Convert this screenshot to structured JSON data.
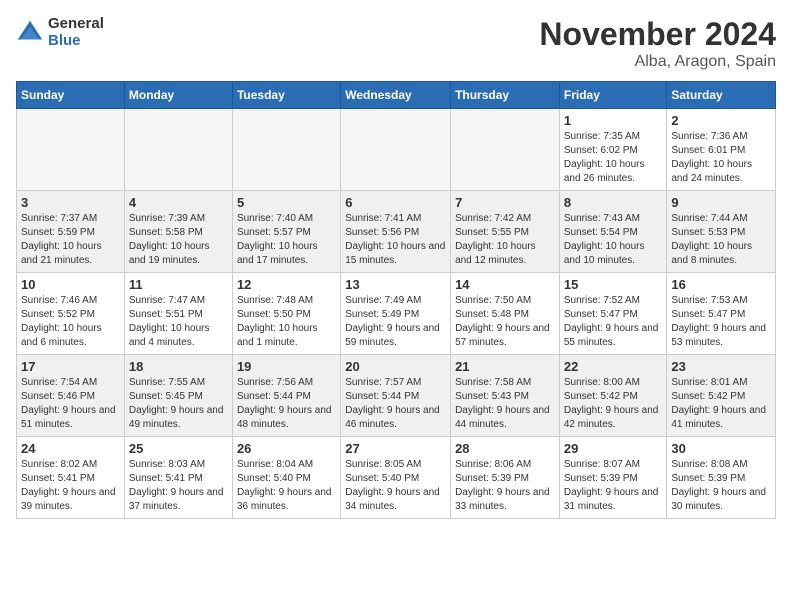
{
  "logo": {
    "general": "General",
    "blue": "Blue"
  },
  "title": "November 2024",
  "location": "Alba, Aragon, Spain",
  "weekdays": [
    "Sunday",
    "Monday",
    "Tuesday",
    "Wednesday",
    "Thursday",
    "Friday",
    "Saturday"
  ],
  "weeks": [
    [
      {
        "day": "",
        "info": ""
      },
      {
        "day": "",
        "info": ""
      },
      {
        "day": "",
        "info": ""
      },
      {
        "day": "",
        "info": ""
      },
      {
        "day": "",
        "info": ""
      },
      {
        "day": "1",
        "info": "Sunrise: 7:35 AM\nSunset: 6:02 PM\nDaylight: 10 hours and 26 minutes."
      },
      {
        "day": "2",
        "info": "Sunrise: 7:36 AM\nSunset: 6:01 PM\nDaylight: 10 hours and 24 minutes."
      }
    ],
    [
      {
        "day": "3",
        "info": "Sunrise: 7:37 AM\nSunset: 5:59 PM\nDaylight: 10 hours and 21 minutes."
      },
      {
        "day": "4",
        "info": "Sunrise: 7:39 AM\nSunset: 5:58 PM\nDaylight: 10 hours and 19 minutes."
      },
      {
        "day": "5",
        "info": "Sunrise: 7:40 AM\nSunset: 5:57 PM\nDaylight: 10 hours and 17 minutes."
      },
      {
        "day": "6",
        "info": "Sunrise: 7:41 AM\nSunset: 5:56 PM\nDaylight: 10 hours and 15 minutes."
      },
      {
        "day": "7",
        "info": "Sunrise: 7:42 AM\nSunset: 5:55 PM\nDaylight: 10 hours and 12 minutes."
      },
      {
        "day": "8",
        "info": "Sunrise: 7:43 AM\nSunset: 5:54 PM\nDaylight: 10 hours and 10 minutes."
      },
      {
        "day": "9",
        "info": "Sunrise: 7:44 AM\nSunset: 5:53 PM\nDaylight: 10 hours and 8 minutes."
      }
    ],
    [
      {
        "day": "10",
        "info": "Sunrise: 7:46 AM\nSunset: 5:52 PM\nDaylight: 10 hours and 6 minutes."
      },
      {
        "day": "11",
        "info": "Sunrise: 7:47 AM\nSunset: 5:51 PM\nDaylight: 10 hours and 4 minutes."
      },
      {
        "day": "12",
        "info": "Sunrise: 7:48 AM\nSunset: 5:50 PM\nDaylight: 10 hours and 1 minute."
      },
      {
        "day": "13",
        "info": "Sunrise: 7:49 AM\nSunset: 5:49 PM\nDaylight: 9 hours and 59 minutes."
      },
      {
        "day": "14",
        "info": "Sunrise: 7:50 AM\nSunset: 5:48 PM\nDaylight: 9 hours and 57 minutes."
      },
      {
        "day": "15",
        "info": "Sunrise: 7:52 AM\nSunset: 5:47 PM\nDaylight: 9 hours and 55 minutes."
      },
      {
        "day": "16",
        "info": "Sunrise: 7:53 AM\nSunset: 5:47 PM\nDaylight: 9 hours and 53 minutes."
      }
    ],
    [
      {
        "day": "17",
        "info": "Sunrise: 7:54 AM\nSunset: 5:46 PM\nDaylight: 9 hours and 51 minutes."
      },
      {
        "day": "18",
        "info": "Sunrise: 7:55 AM\nSunset: 5:45 PM\nDaylight: 9 hours and 49 minutes."
      },
      {
        "day": "19",
        "info": "Sunrise: 7:56 AM\nSunset: 5:44 PM\nDaylight: 9 hours and 48 minutes."
      },
      {
        "day": "20",
        "info": "Sunrise: 7:57 AM\nSunset: 5:44 PM\nDaylight: 9 hours and 46 minutes."
      },
      {
        "day": "21",
        "info": "Sunrise: 7:58 AM\nSunset: 5:43 PM\nDaylight: 9 hours and 44 minutes."
      },
      {
        "day": "22",
        "info": "Sunrise: 8:00 AM\nSunset: 5:42 PM\nDaylight: 9 hours and 42 minutes."
      },
      {
        "day": "23",
        "info": "Sunrise: 8:01 AM\nSunset: 5:42 PM\nDaylight: 9 hours and 41 minutes."
      }
    ],
    [
      {
        "day": "24",
        "info": "Sunrise: 8:02 AM\nSunset: 5:41 PM\nDaylight: 9 hours and 39 minutes."
      },
      {
        "day": "25",
        "info": "Sunrise: 8:03 AM\nSunset: 5:41 PM\nDaylight: 9 hours and 37 minutes."
      },
      {
        "day": "26",
        "info": "Sunrise: 8:04 AM\nSunset: 5:40 PM\nDaylight: 9 hours and 36 minutes."
      },
      {
        "day": "27",
        "info": "Sunrise: 8:05 AM\nSunset: 5:40 PM\nDaylight: 9 hours and 34 minutes."
      },
      {
        "day": "28",
        "info": "Sunrise: 8:06 AM\nSunset: 5:39 PM\nDaylight: 9 hours and 33 minutes."
      },
      {
        "day": "29",
        "info": "Sunrise: 8:07 AM\nSunset: 5:39 PM\nDaylight: 9 hours and 31 minutes."
      },
      {
        "day": "30",
        "info": "Sunrise: 8:08 AM\nSunset: 5:39 PM\nDaylight: 9 hours and 30 minutes."
      }
    ]
  ]
}
